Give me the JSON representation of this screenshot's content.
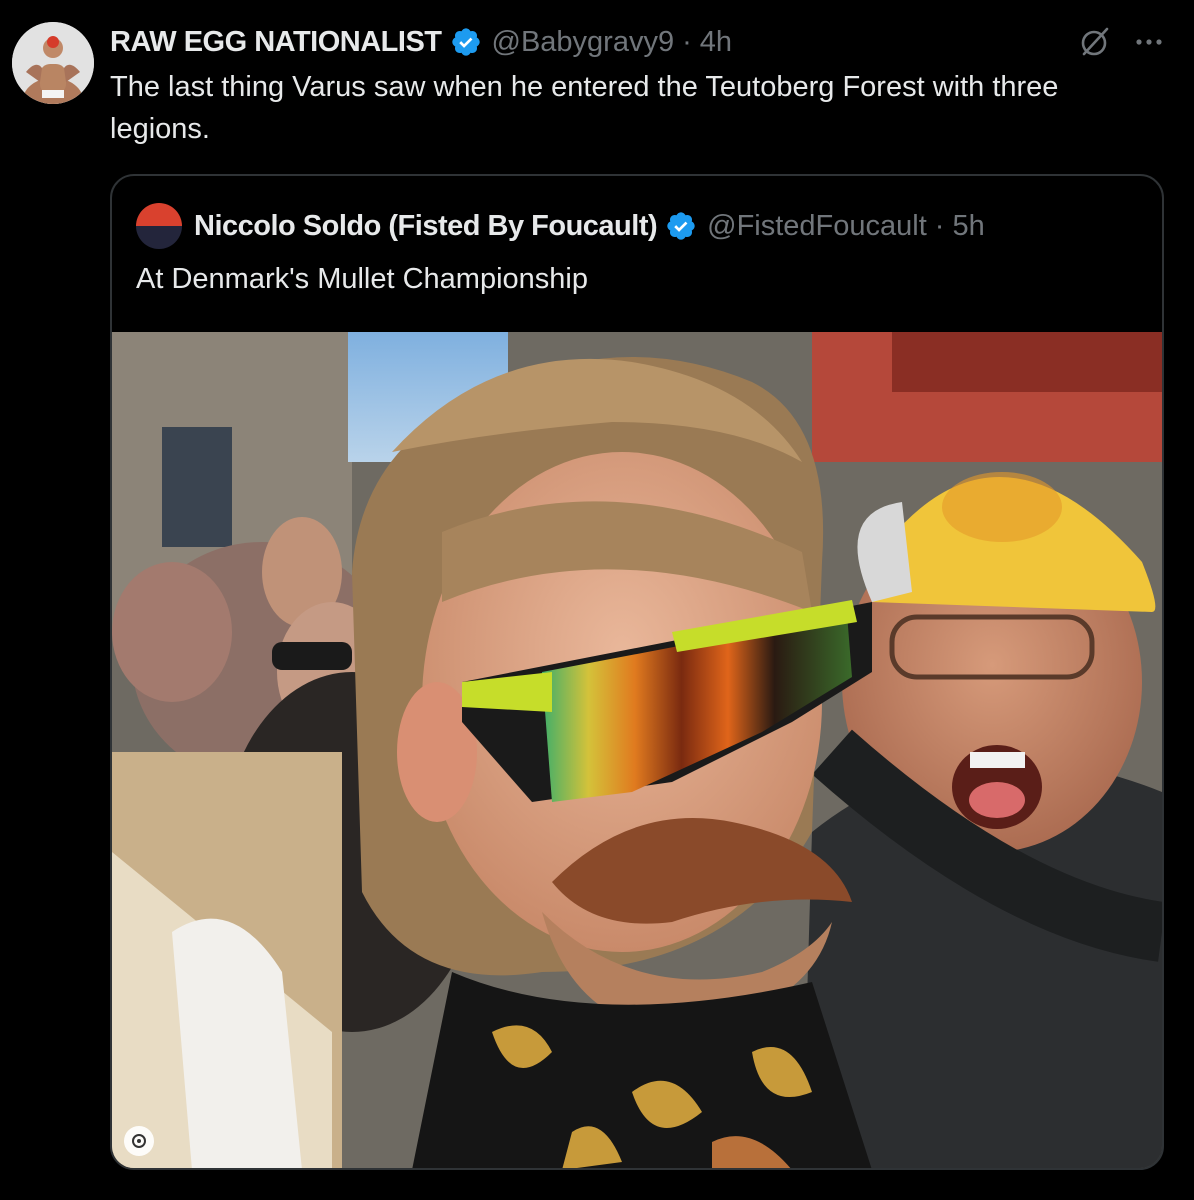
{
  "tweet": {
    "display_name": "RAW EGG NATIONALIST",
    "handle": "@Babygravy9",
    "separator": "·",
    "time": "4h",
    "text": "The last thing Varus saw when he entered the Teutoberg Forest with three legions.",
    "icons": {
      "verified": "verified-badge-icon",
      "grok": "grok-icon",
      "more": "more-icon"
    }
  },
  "quoted_tweet": {
    "display_name": "Niccolo Soldo (Fisted By Foucault)",
    "handle": "@FistedFoucault",
    "separator": "·",
    "time": "5h",
    "text": "At Denmark's Mullet Championship",
    "media_alt": "photo"
  },
  "colors": {
    "background": "#000000",
    "text_primary": "#e7e9ea",
    "text_secondary": "#71767b",
    "border": "#2f3336",
    "verified_blue": "#1d9bf0"
  }
}
